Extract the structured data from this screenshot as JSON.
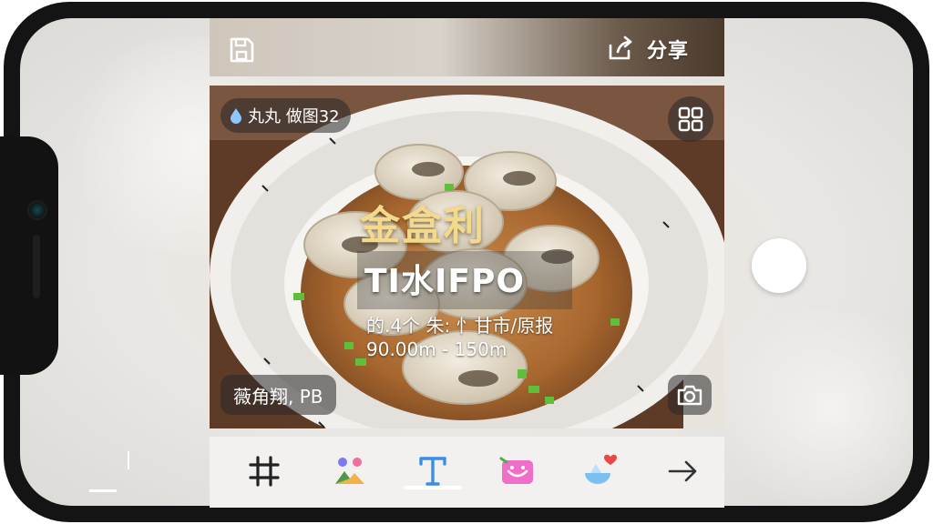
{
  "header": {
    "share_label": "分享"
  },
  "photo": {
    "top_badge": "丸丸 做图32",
    "bottom_badge": "薇角翔, PB"
  },
  "overlay": {
    "title": "金盒利",
    "subtitle": "TI水IFPO",
    "line1": "的.4个 朱: 忄甘市/原报",
    "line2": "90.00m - 150m"
  },
  "toolbar": {
    "tools": [
      "crop-icon",
      "filter-icon",
      "text-icon",
      "sticker-icon",
      "effect-icon",
      "next-arrow-icon"
    ],
    "active_tool": "text-icon"
  },
  "colors": {
    "title_gold": "#f3d98c",
    "active_blue": "#3b8ee8",
    "toolbar_bg": "#f2f1f0"
  }
}
